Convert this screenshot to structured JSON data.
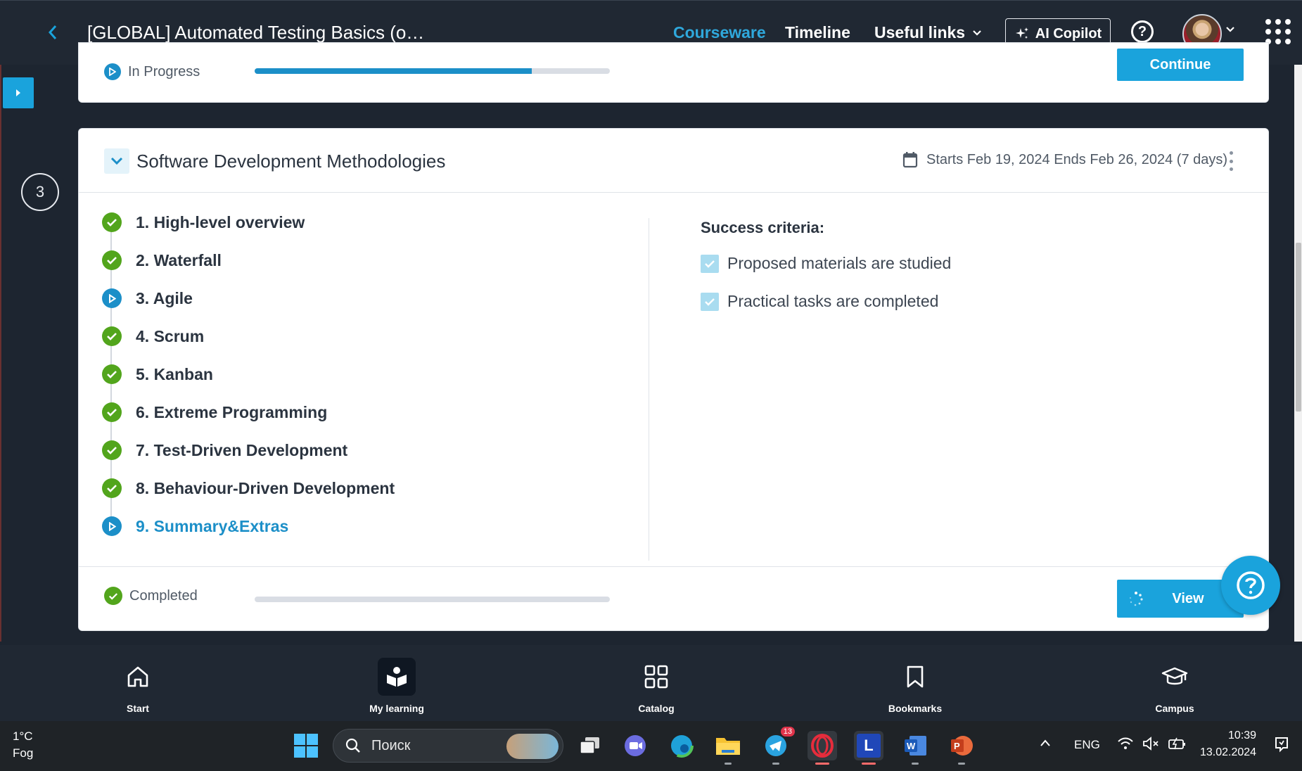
{
  "header": {
    "course_title": "[GLOBAL] Automated Testing Basics (o…",
    "tabs": [
      {
        "label": "Courseware",
        "active": true
      },
      {
        "label": "Timeline",
        "active": false
      },
      {
        "label": "Useful links",
        "active": false
      }
    ],
    "copilot_label": "AI Copilot",
    "help_label": "?"
  },
  "previous_module": {
    "status": "In Progress",
    "progress_percent": 78,
    "button_label": "Continue"
  },
  "step_number": "3",
  "module": {
    "title": "Software Development Methodologies",
    "dates": "Starts Feb 19, 2024 Ends Feb 26, 2024 (7 days)",
    "lessons": [
      {
        "label": "1. High-level overview",
        "state": "completed"
      },
      {
        "label": "2. Waterfall",
        "state": "completed"
      },
      {
        "label": "3. Agile",
        "state": "in-progress"
      },
      {
        "label": "4. Scrum",
        "state": "completed"
      },
      {
        "label": "5. Kanban",
        "state": "completed"
      },
      {
        "label": "6. Extreme Programming",
        "state": "completed"
      },
      {
        "label": "7. Test-Driven Development",
        "state": "completed"
      },
      {
        "label": "8. Behaviour-Driven Development",
        "state": "completed"
      },
      {
        "label": "9. Summary&Extras",
        "state": "current"
      }
    ],
    "success_criteria_title": "Success criteria:",
    "success_criteria": [
      {
        "label": "Proposed materials are studied",
        "checked": true
      },
      {
        "label": "Practical tasks are completed",
        "checked": true
      }
    ],
    "footer_status": "Completed",
    "footer_progress_percent": 0,
    "view_button_label": "View"
  },
  "bottom_nav": [
    {
      "label": "Start",
      "icon": "home-icon",
      "active": false
    },
    {
      "label": "My learning",
      "icon": "my-learning-icon",
      "active": true
    },
    {
      "label": "Catalog",
      "icon": "catalog-icon",
      "active": false
    },
    {
      "label": "Bookmarks",
      "icon": "bookmark-icon",
      "active": false
    },
    {
      "label": "Campus",
      "icon": "campus-icon",
      "active": false
    }
  ],
  "taskbar": {
    "weather_temp": "1°C",
    "weather_condition": "Fog",
    "search_placeholder": "Поиск",
    "telegram_badge": "13",
    "language": "ENG",
    "time": "10:39",
    "date": "13.02.2024"
  },
  "colors": {
    "accent": "#1aa3dc",
    "completed_green": "#52a51c",
    "header_bg": "#202833"
  }
}
